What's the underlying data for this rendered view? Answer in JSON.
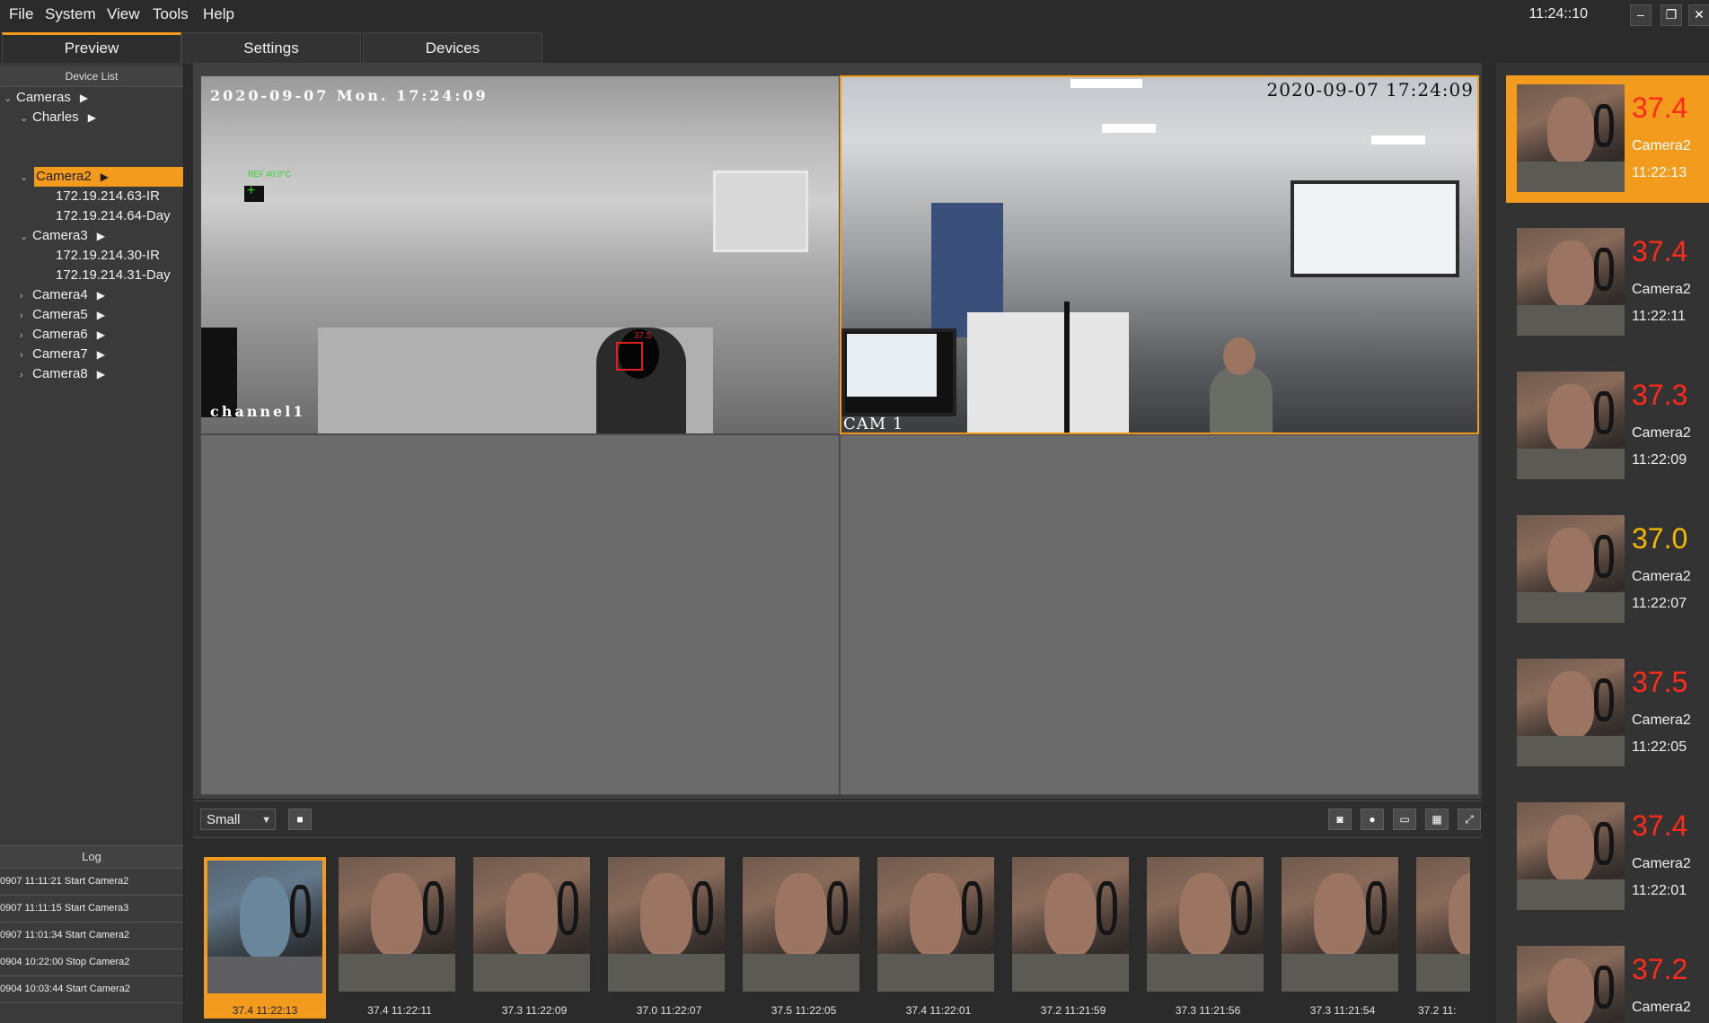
{
  "menu": [
    "File",
    "System",
    "View",
    "Tools",
    "Help"
  ],
  "clock": "11:24::10",
  "window_controls": {
    "minimize": "‒",
    "restore": "❐",
    "close": "✕"
  },
  "tabs": [
    {
      "label": "Preview",
      "active": true
    },
    {
      "label": "Settings",
      "active": false
    },
    {
      "label": "Devices",
      "active": false
    }
  ],
  "device_list": {
    "header": "Device List",
    "items": [
      {
        "label": "Cameras",
        "arrow": "▶"
      },
      {
        "label": "Charles",
        "arrow": "▶"
      },
      {
        "label": "Camera2",
        "arrow": "▶",
        "selected": true
      },
      {
        "label": "172.19.214.63-IR"
      },
      {
        "label": "172.19.214.64-Day"
      },
      {
        "label": "Camera3",
        "arrow": "▶"
      },
      {
        "label": "172.19.214.30-IR"
      },
      {
        "label": "172.19.214.31-Day"
      },
      {
        "label": "Camera4",
        "arrow": "▶"
      },
      {
        "label": "Camera5",
        "arrow": "▶"
      },
      {
        "label": "Camera6",
        "arrow": "▶"
      },
      {
        "label": "Camera7",
        "arrow": "▶"
      },
      {
        "label": "Camera8",
        "arrow": "▶"
      }
    ]
  },
  "log": {
    "header": "Log",
    "entries": [
      "0907 11:11:21 Start Camera2",
      "0907 11:11:15 Start Camera3",
      "0907 11:01:34 Start Camera2",
      "0904 10:22:00 Stop Camera2",
      "0904 10:03:44 Start Camera2"
    ]
  },
  "video": {
    "ir_timestamp": "2020-09-07 Mon. 17:24:09",
    "ir_channel": "channel1",
    "ir_ref_label": "REF 40.0°C",
    "ir_box_temp": "37.5",
    "rgb_timestamp": "2020-09-07 17:24:09",
    "rgb_channel": "CAM 1"
  },
  "toolbar": {
    "size_value": "Small",
    "stop_icon": "stop-icon",
    "buttons": [
      "camera-icon",
      "record-icon",
      "folder-icon",
      "grid-icon",
      "fullscreen-icon"
    ]
  },
  "captures": [
    {
      "label": "37.4 11:22:13",
      "selected": true
    },
    {
      "label": "37.4 11:22:11"
    },
    {
      "label": "37.3 11:22:09"
    },
    {
      "label": "37.0 11:22:07"
    },
    {
      "label": "37.5 11:22:05"
    },
    {
      "label": "37.4 11:22:01"
    },
    {
      "label": "37.2 11:21:59"
    },
    {
      "label": "37.3 11:21:56"
    },
    {
      "label": "37.3 11:21:54"
    },
    {
      "label": "37.2 11:"
    }
  ],
  "alerts": [
    {
      "temp": "37.4",
      "camera": "Camera2",
      "time": "11:22:13",
      "color": "#ff2a1a",
      "selected": true
    },
    {
      "temp": "37.4",
      "camera": "Camera2",
      "time": "11:22:11",
      "color": "#ff2a1a"
    },
    {
      "temp": "37.3",
      "camera": "Camera2",
      "time": "11:22:09",
      "color": "#ff2a1a"
    },
    {
      "temp": "37.0",
      "camera": "Camera2",
      "time": "11:22:07",
      "color": "#f5b800"
    },
    {
      "temp": "37.5",
      "camera": "Camera2",
      "time": "11:22:05",
      "color": "#ff2a1a"
    },
    {
      "temp": "37.4",
      "camera": "Camera2",
      "time": "11:22:01",
      "color": "#ff2a1a"
    },
    {
      "temp": "37.2",
      "camera": "Camera2",
      "time": "",
      "color": "#ff2a1a"
    }
  ],
  "colors": {
    "accent": "#f39b1d",
    "alert_red": "#ff2a1a",
    "alert_yellow": "#f5b800"
  }
}
